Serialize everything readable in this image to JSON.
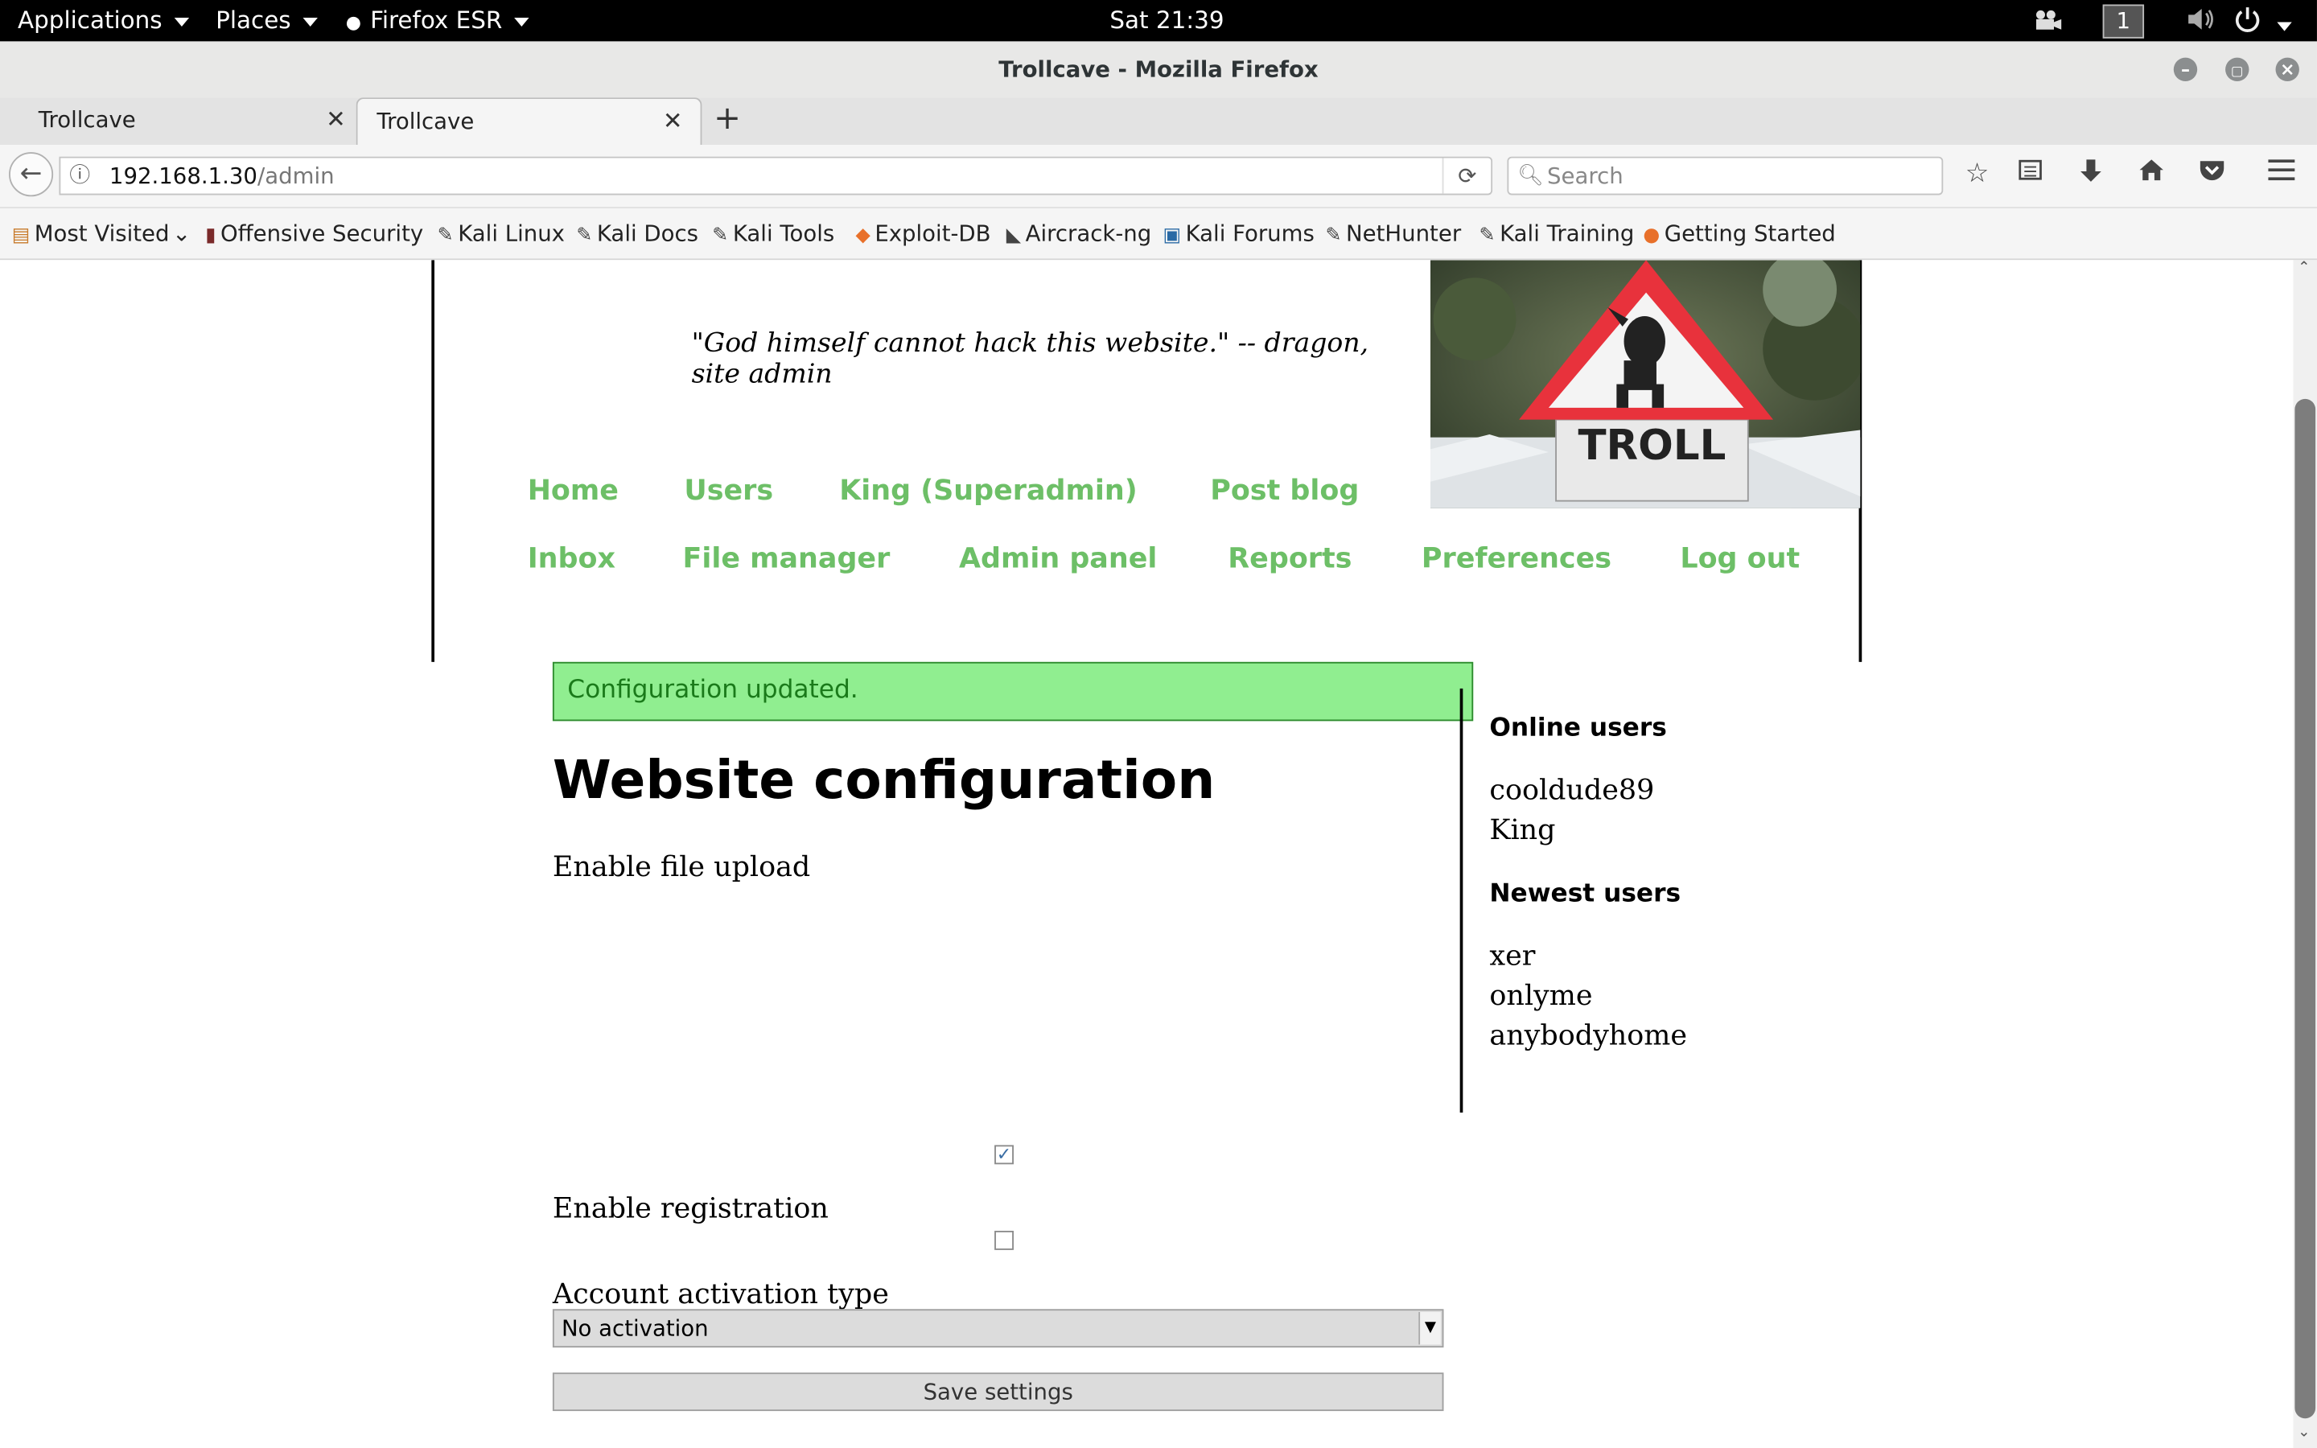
{
  "topbar": {
    "applications": "Applications",
    "places": "Places",
    "firefox": "Firefox ESR",
    "clock": "Sat 21:39",
    "workspace": "1"
  },
  "window": {
    "title": "Trollcave - Mozilla Firefox"
  },
  "tabs": [
    {
      "label": "Trollcave"
    },
    {
      "label": "Trollcave"
    }
  ],
  "navbar": {
    "url_host": "192.168.1.30",
    "url_path": "/admin",
    "search_placeholder": "Search"
  },
  "bookmarks": [
    {
      "label": "Most Visited",
      "icon": "folder-icon"
    },
    {
      "label": "Offensive Security",
      "icon": "offsec-icon"
    },
    {
      "label": "Kali Linux",
      "icon": "kali-icon"
    },
    {
      "label": "Kali Docs",
      "icon": "kali-icon"
    },
    {
      "label": "Kali Tools",
      "icon": "kali-icon"
    },
    {
      "label": "Exploit-DB",
      "icon": "exploitdb-icon"
    },
    {
      "label": "Aircrack-ng",
      "icon": "aircrack-icon"
    },
    {
      "label": "Kali Forums",
      "icon": "kali-forums-icon"
    },
    {
      "label": "NetHunter",
      "icon": "kali-icon"
    },
    {
      "label": "Kali Training",
      "icon": "kali-icon"
    },
    {
      "label": "Getting Started",
      "icon": "firefox-icon"
    }
  ],
  "site": {
    "tagline": "\"God himself cannot hack this website.\" -- dragon, site admin",
    "troll_sign_text": "TROLL",
    "nav_row1": [
      "Home",
      "Users",
      "King (Superadmin)",
      "Post blog"
    ],
    "nav_row2": [
      "Inbox",
      "File manager",
      "Admin panel",
      "Reports",
      "Preferences",
      "Log out"
    ]
  },
  "main": {
    "alert": "Configuration updated.",
    "heading": "Website configuration",
    "upload_label": "Enable file upload",
    "upload_checked": true,
    "registration_label": "Enable registration",
    "registration_checked": false,
    "activation_label": "Account activation type",
    "activation_value": "No activation",
    "save_label": "Save settings"
  },
  "sidebar": {
    "online_heading": "Online users",
    "online_users": [
      "cooldude89",
      "King"
    ],
    "newest_heading": "Newest users",
    "newest_users": [
      "xer",
      "onlyme",
      "anybodyhome"
    ]
  },
  "colors": {
    "nav_link": "#6dbf67",
    "alert_bg": "#90ee90",
    "alert_text": "#1a7a1a"
  }
}
